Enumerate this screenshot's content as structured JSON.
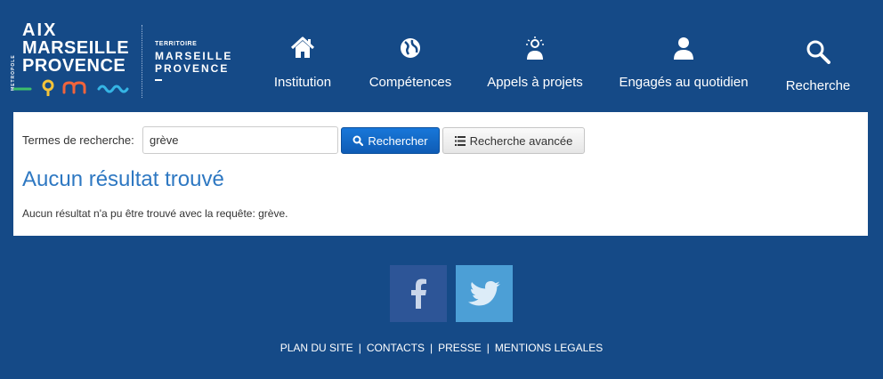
{
  "logo": {
    "metropole": "METROPOLE",
    "aix": "AIX",
    "marseille": "MARSEILLE",
    "provence": "PROVENCE",
    "territoire": "TERRITOIRE",
    "territory_line1": "MARSEILLE",
    "territory_line2": "PROVENCE"
  },
  "nav": {
    "items": [
      {
        "label": "Institution",
        "icon": "house-icon"
      },
      {
        "label": "Compétences",
        "icon": "compass-icon"
      },
      {
        "label": "Appels à projets",
        "icon": "lightbulb-person-icon"
      },
      {
        "label": "Engagés au quotidien",
        "icon": "person-icon"
      },
      {
        "label": "Recherche",
        "icon": "search-icon"
      }
    ]
  },
  "search": {
    "label": "Termes de recherche:",
    "value": "grève",
    "submit_label": "Rechercher",
    "advanced_label": "Recherche avancée"
  },
  "results": {
    "title": "Aucun résultat trouvé",
    "message": "Aucun résultat n'a pu être trouvé avec la requête: grève."
  },
  "social": {
    "facebook": "facebook-icon",
    "twitter": "twitter-icon"
  },
  "footer": {
    "links": [
      "PLAN DU SITE",
      "CONTACTS",
      "PRESSE",
      "MENTIONS LEGALES"
    ],
    "separator": "|"
  },
  "colors": {
    "background": "#154a87",
    "accent_blue": "#2e78c2",
    "button_blue": "#1877d9",
    "logo_green": "#3dbe6b",
    "logo_yellow": "#f3c43a",
    "logo_orange": "#f0643c",
    "logo_cyan": "#35b5e5"
  }
}
